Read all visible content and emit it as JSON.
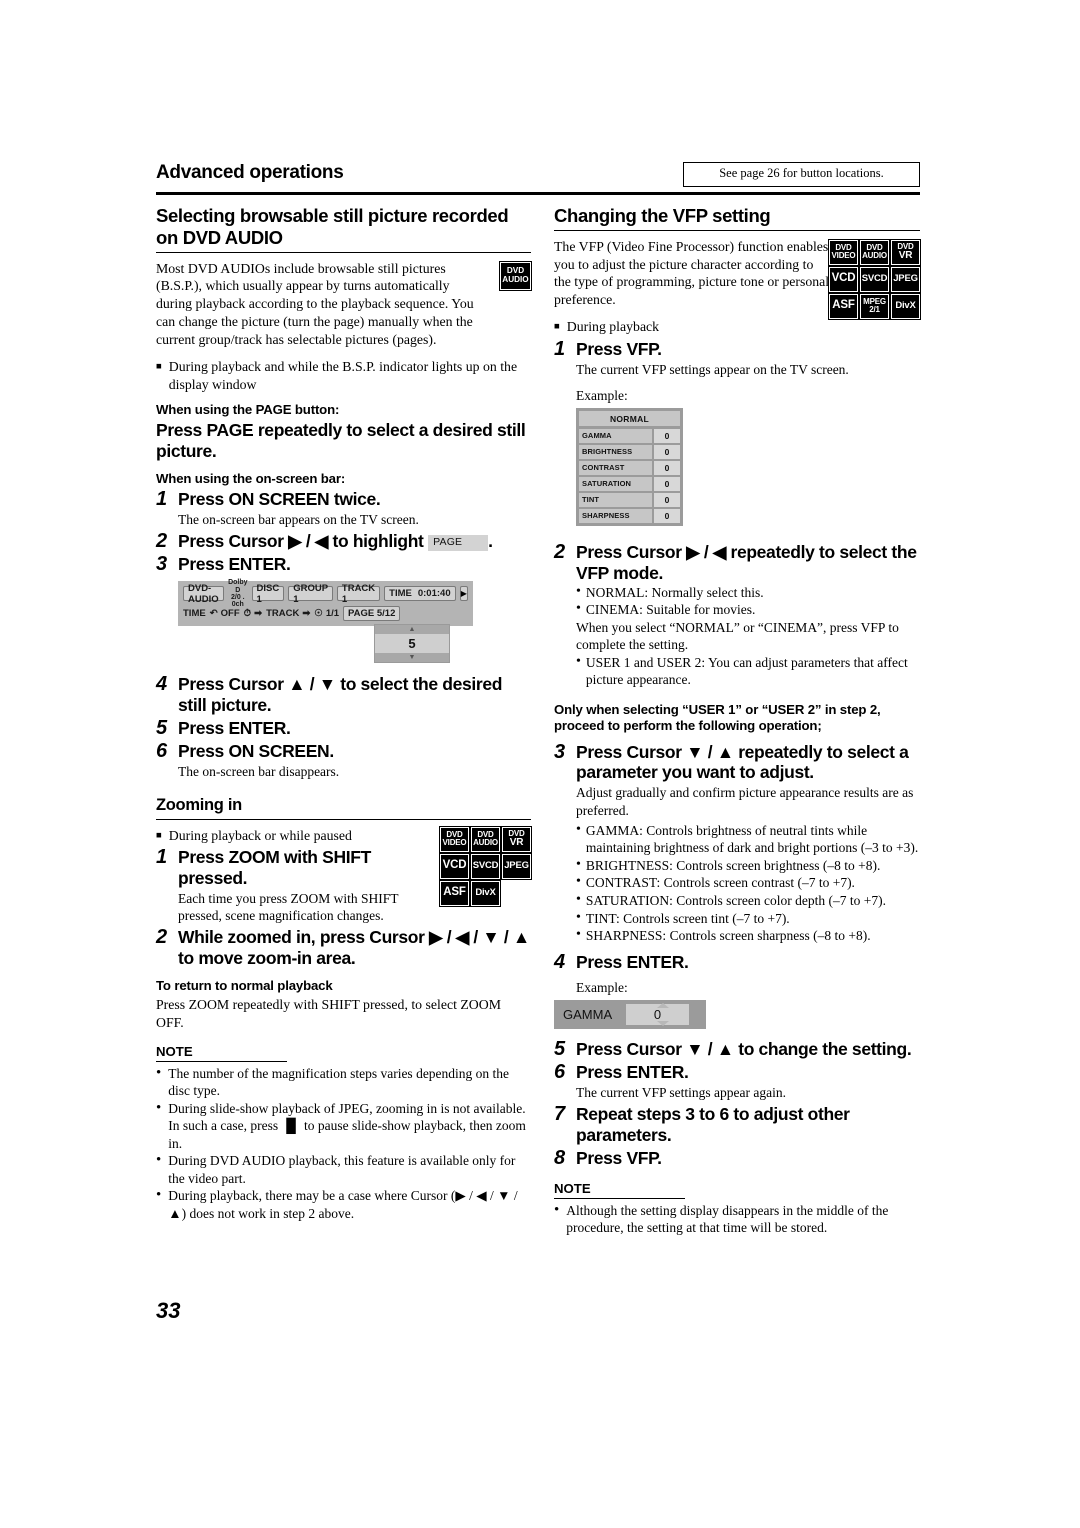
{
  "header": {
    "title": "Advanced operations",
    "see_also": "See page 26 for button locations."
  },
  "page_number": "33",
  "left_column": {
    "section_title": "Selecting browsable still picture recorded on DVD AUDIO",
    "lead_paragraph": "Most DVD AUDIOs include browsable still pictures (B.S.P.), which usually appear by turns automatically during playback according to the playback sequence. You can change the picture (turn the page) manually when the current group/track has selectable pictures (pages).",
    "lead_badge": {
      "line1": "DVD",
      "line2": "AUDIO"
    },
    "bullet_condition": "During playback and while the B.S.P. indicator lights up on the display window",
    "page_button_caption": "When using the PAGE button:",
    "page_button_instruction": "Press PAGE repeatedly to select a desired still picture.",
    "onscreen_caption": "When using the on-screen bar:",
    "steps": [
      {
        "num": "1",
        "text": "Press ON SCREEN twice.",
        "desc": "The on-screen bar appears on the TV screen."
      },
      {
        "num": "2",
        "text_before": "Press Cursor ▶ / ◀ to highlight",
        "chip": "PAGE",
        "text_after": ".",
        "desc": ""
      },
      {
        "num": "3",
        "text": "Press ENTER.",
        "desc": ""
      },
      {
        "num": "4",
        "text": "Press Cursor ▲ / ▼ to select the desired still picture.",
        "desc": ""
      },
      {
        "num": "5",
        "text": "Press ENTER.",
        "desc": ""
      },
      {
        "num": "6",
        "text": "Press ON SCREEN.",
        "desc": "The on-screen bar disappears."
      }
    ],
    "onscreen_bar": {
      "disc_type": "DVD-AUDIO",
      "dolby_line1": "Dolby D",
      "dolby_line2": "2/0 . 0ch",
      "disc": "DISC 1",
      "group": "GROUP 1",
      "track": "TRACK 1",
      "time_label": "TIME",
      "time_value": "0:01:40",
      "row2_time": "TIME",
      "repeat": "OFF",
      "track_skip": "TRACK",
      "chapter": "1/1",
      "page_field": "PAGE 5/12",
      "popup_value": "5"
    },
    "zoom_section": {
      "title": "Zooming in",
      "bullet_condition": "During playback or while paused",
      "badges": [
        [
          {
            "l1": "DVD",
            "l2": "VIDEO"
          },
          {
            "l1": "DVD",
            "l2": "AUDIO"
          },
          {
            "l1": "DVD",
            "l2": "VR"
          }
        ],
        [
          {
            "one": "VCD"
          },
          {
            "one": "SVCD"
          },
          {
            "one": "JPEG"
          }
        ],
        [
          {
            "one": "ASF"
          },
          {
            "one": "DivX"
          },
          {
            "blank": true
          }
        ]
      ],
      "steps": [
        {
          "num": "1",
          "text": "Press ZOOM with SHIFT pressed.",
          "desc": "Each time you press ZOOM with SHIFT pressed, scene magnification changes."
        },
        {
          "num": "2",
          "text": "While zoomed in, press Cursor ▶ / ◀ / ▼ / ▲ to move zoom-in area.",
          "desc": ""
        }
      ],
      "return_caption": "To return to normal playback",
      "return_text": "Press ZOOM repeatedly with SHIFT pressed, to select ZOOM OFF.",
      "note_heading": "NOTE",
      "notes": [
        "The number of the magnification steps varies depending on the disc type.",
        "During slide-show playback of JPEG, zooming in is not available. In such a case, press ▐▌ to pause slide-show playback, then zoom in.",
        "During DVD AUDIO playback, this feature is available only for the video part.",
        "During playback, there may be a case where Cursor (▶ / ◀ / ▼ / ▲) does not work in step 2 above."
      ]
    }
  },
  "right_column": {
    "section_title": "Changing the VFP setting",
    "lead_paragraph": "The VFP (Video Fine Processor) function enables you to adjust the picture character according to the type of programming, picture tone or personal preference.",
    "badges": [
      [
        {
          "l1": "DVD",
          "l2": "VIDEO"
        },
        {
          "l1": "DVD",
          "l2": "AUDIO"
        },
        {
          "l1": "DVD",
          "l2": "VR"
        }
      ],
      [
        {
          "one": "VCD"
        },
        {
          "one": "SVCD"
        },
        {
          "one": "JPEG"
        }
      ],
      [
        {
          "one": "ASF"
        },
        {
          "l1": "MPEG",
          "l2": "2/1"
        },
        {
          "one": "DivX"
        }
      ]
    ],
    "bullet_condition": "During playback",
    "step1": {
      "num": "1",
      "text": "Press VFP.",
      "desc": "The current VFP settings appear on the TV screen.",
      "example_label": "Example:"
    },
    "vfp_panel": {
      "title": "NORMAL",
      "rows": [
        {
          "name": "GAMMA",
          "value": "0"
        },
        {
          "name": "BRIGHTNESS",
          "value": "0"
        },
        {
          "name": "CONTRAST",
          "value": "0"
        },
        {
          "name": "SATURATION",
          "value": "0"
        },
        {
          "name": "TINT",
          "value": "0"
        },
        {
          "name": "SHARPNESS",
          "value": "0"
        }
      ]
    },
    "step2": {
      "num": "2",
      "text": "Press Cursor ▶ / ◀ repeatedly to select the VFP mode.",
      "bullets": [
        "NORMAL: Normally select this.",
        "CINEMA: Suitable for movies."
      ],
      "middle_text": "When you select “NORMAL” or “CINEMA”, press VFP to complete the setting.",
      "last_bullet": "USER 1 and USER 2: You can adjust parameters that affect picture appearance."
    },
    "only_when_note": "Only when selecting “USER 1” or “USER 2” in step 2, proceed to perform the following operation;",
    "step3": {
      "num": "3",
      "text": "Press Cursor ▼ / ▲ repeatedly to select a parameter you want to adjust.",
      "desc": "Adjust gradually and confirm picture appearance results are as preferred.",
      "bullets": [
        "GAMMA: Controls brightness of neutral tints while maintaining brightness of dark and bright portions (–3 to +3).",
        "BRIGHTNESS: Controls screen brightness (–8 to +8).",
        "CONTRAST: Controls screen contrast (–7 to +7).",
        "SATURATION: Controls screen color depth (–7 to +7).",
        "TINT: Controls screen tint (–7 to +7).",
        "SHARPNESS: Controls screen sharpness (–8 to +8)."
      ]
    },
    "step4": {
      "num": "4",
      "text": "Press ENTER.",
      "example_label": "Example:"
    },
    "gamma_bar": {
      "name": "GAMMA",
      "value": "0"
    },
    "step5": {
      "num": "5",
      "text": "Press Cursor ▼ / ▲ to change the setting."
    },
    "step6": {
      "num": "6",
      "text": "Press ENTER.",
      "desc": "The current VFP settings appear again."
    },
    "step7": {
      "num": "7",
      "text": "Repeat steps 3 to 6 to adjust other parameters."
    },
    "step8": {
      "num": "8",
      "text": "Press VFP."
    },
    "note_heading": "NOTE",
    "notes": [
      "Although the setting display disappears in the middle of the procedure, the setting at that time will be stored."
    ]
  }
}
